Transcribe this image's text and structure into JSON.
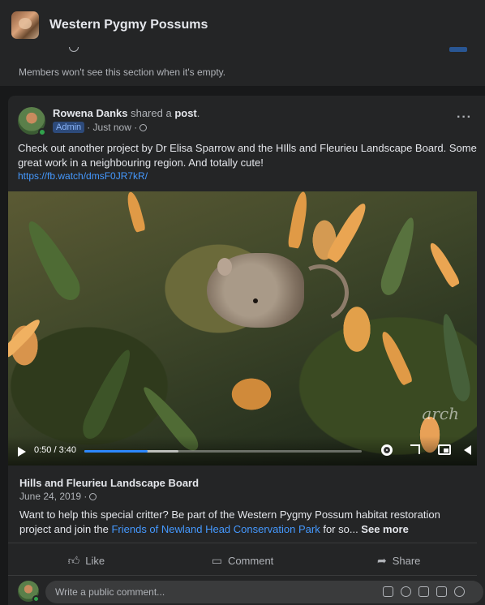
{
  "group": {
    "title": "Western Pygmy Possums"
  },
  "featured": {
    "empty_note": "Members won't see this section when it's empty."
  },
  "post": {
    "author": "Rowena Danks",
    "verb": " shared a ",
    "object": "post",
    "badge": "Admin",
    "time": " · Just now · ",
    "text": "Check out another project by Dr Elisa Sparrow and the HIlls and Fleurieu Landscape Board. Some great work in a neighbouring region. And totally cute!",
    "link": "https://fb.watch/dmsF0JR7kR/",
    "more": "···"
  },
  "video": {
    "time": "0:50 / 3:40",
    "progress": 0.227,
    "watermark": "arch"
  },
  "shared": {
    "page": "Hills and Fleurieu Landscape Board",
    "date": "June 24, 2019 · ",
    "text_pre": "Want to help this special critter? Be part of the Western Pygmy Possum habitat restoration project and join the ",
    "text_link": "Friends of Newland Head Conservation Park",
    "text_post": " for so... ",
    "see_more": "See more"
  },
  "actions": {
    "like": "Like",
    "comment": "Comment",
    "share": "Share"
  },
  "comment": {
    "placeholder": "Write a public comment..."
  },
  "colors": {
    "accent": "#2d88ff",
    "link": "#4599ff",
    "online": "#31a24c",
    "background": "#18191a",
    "card": "#242526"
  }
}
